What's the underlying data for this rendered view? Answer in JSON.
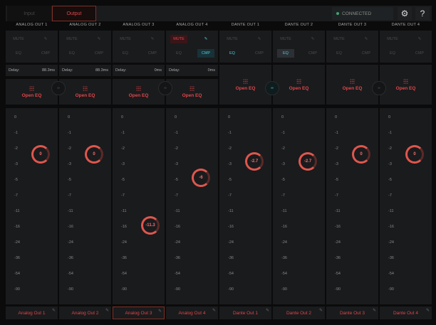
{
  "tabs": [
    {
      "label": "Input",
      "active": false
    },
    {
      "label": "Output",
      "active": true
    }
  ],
  "status": "CONNECTED",
  "icons": {
    "settings": "gear-icon",
    "help": "?"
  },
  "scale": [
    "0",
    "-1",
    "-2",
    "-3",
    "-5",
    "-7",
    "-11",
    "-16",
    "-24",
    "-36",
    "-54",
    "-90"
  ],
  "labels": {
    "mute": "MUTE",
    "eq": "EQ",
    "cmp": "CMP",
    "delay": "Delay:",
    "open_eq": "Open EQ",
    "link": "∞"
  },
  "channels": [
    {
      "header": "ANALOG OUT 1",
      "name": "Analog Out 1",
      "delay": "88.3ms",
      "value": "0",
      "v": 0,
      "mute": false,
      "eq": false,
      "cmp": false,
      "selected": false
    },
    {
      "header": "ANALOG OUT 2",
      "name": "Analog Out 2",
      "delay": "88.3ms",
      "value": "0",
      "v": 0,
      "mute": false,
      "eq": false,
      "cmp": false,
      "selected": false
    },
    {
      "header": "ANALOG OUT 3",
      "name": "Analog Out 3",
      "delay": "0ms",
      "value": "-11.3",
      "v": -11.3,
      "mute": false,
      "eq": false,
      "cmp": false,
      "selected": true
    },
    {
      "header": "ANALOG OUT 4",
      "name": "Analog Out 4",
      "delay": "0ms",
      "value": "-6",
      "v": -6,
      "mute": true,
      "eq": false,
      "cmp": true,
      "selected": false
    },
    {
      "header": "DANTE OUT 1",
      "name": "Dante Out 1",
      "value": "-2.7",
      "v": -2.7,
      "mute": false,
      "eq": true,
      "cmp": false,
      "selected": false
    },
    {
      "header": "DANTE OUT 2",
      "name": "Dante Out 2",
      "value": "-2.7",
      "v": -2.7,
      "mute": false,
      "eq": true,
      "cmp": false,
      "selected": false
    },
    {
      "header": "DANTE OUT 3",
      "name": "Dante Out 3",
      "value": "0",
      "v": 0,
      "mute": false,
      "eq": false,
      "cmp": false,
      "selected": false
    },
    {
      "header": "DANTE OUT 4",
      "name": "Dante Out 4",
      "value": "0",
      "v": 0,
      "mute": false,
      "eq": false,
      "cmp": false,
      "selected": false
    }
  ],
  "links": [
    false,
    false,
    true,
    false
  ]
}
